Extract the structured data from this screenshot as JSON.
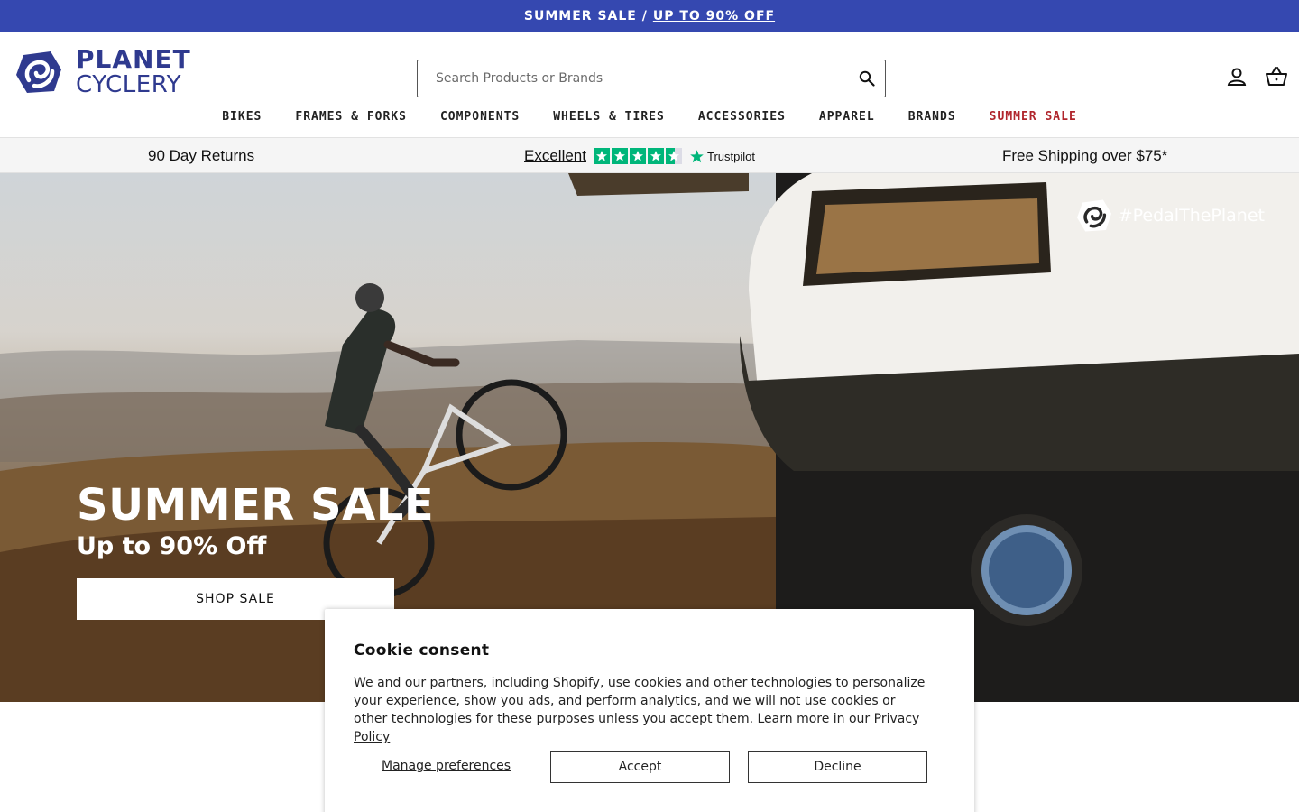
{
  "announcement": {
    "prefix": "SUMMER SALE /",
    "link": "UP TO 90% OFF"
  },
  "brand": {
    "line1": "PLANET",
    "line2": "CYCLERY",
    "color": "#2f3a8f"
  },
  "search": {
    "placeholder": "Search Products or Brands",
    "icon": "search-icon"
  },
  "header_icons": [
    "account-icon",
    "cart-icon"
  ],
  "nav": [
    {
      "label": "BIKES"
    },
    {
      "label": "FRAMES & FORKS"
    },
    {
      "label": "COMPONENTS"
    },
    {
      "label": "WHEELS & TIRES"
    },
    {
      "label": "ACCESSORIES"
    },
    {
      "label": "APPAREL"
    },
    {
      "label": "BRANDS"
    },
    {
      "label": "SUMMER SALE"
    }
  ],
  "trust_bar": {
    "returns": "90 Day Returns",
    "rating": "Excellent",
    "trustpilot": "Trustpilot",
    "shipping": "Free Shipping over $75*"
  },
  "hero": {
    "hashtag": "#PedalThePlanet",
    "title": "SUMMER SALE",
    "subtitle": "Up to 90% Off",
    "cta": "SHOP SALE"
  },
  "cookie": {
    "title": "Cookie consent",
    "body": "We and our partners, including Shopify, use cookies and other technologies to personalize your experience, show you ads, and perform analytics, and we will not use cookies or other technologies for these purposes unless you accept them. Learn more in our",
    "policy_link": "Privacy Policy",
    "manage": "Manage preferences",
    "accept": "Accept",
    "decline": "Decline"
  },
  "colors": {
    "announcement_bg": "#3548b0",
    "sale_red": "#b0252c",
    "trustpilot_green": "#00b67a"
  }
}
